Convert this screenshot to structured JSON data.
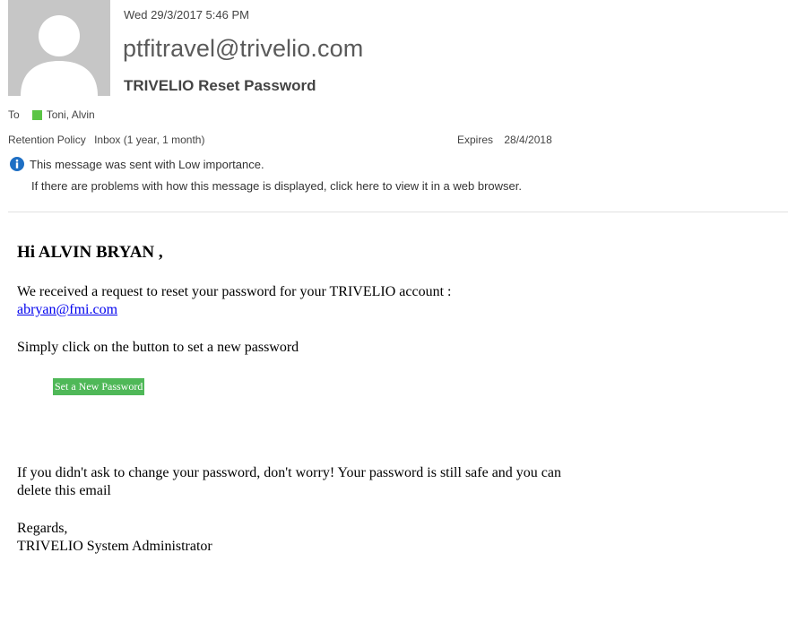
{
  "header": {
    "date": "Wed 29/3/2017 5:46 PM",
    "sender": "ptfitravel@trivelio.com",
    "subject": "TRIVELIO Reset Password",
    "to_label": "To",
    "recipient": "Toni, Alvin",
    "presence_color": "#5bc545",
    "retention_label": "Retention Policy",
    "retention_value": "Inbox (1 year, 1 month)",
    "expires_label": "Expires",
    "expires_value": "28/4/2018",
    "importance_icon": "info-icon",
    "importance_text": "This message was sent with Low importance.",
    "browser_text": "If there are problems with how this message is displayed, click here to view it in a web browser."
  },
  "email": {
    "greeting": "Hi ALVIN BRYAN ,",
    "request_text": "We received a request to reset your password for your TRIVELIO account :",
    "account_email": "abryan@fmi.com",
    "instruction": "Simply click on the button to set a new password",
    "button_label": "Set a New Password",
    "button_color": "#4fb858",
    "reassurance_line1": "If you didn't ask to change your password, don't worry! Your password is still safe and you can",
    "reassurance_line2": "delete this email",
    "closing": "Regards,",
    "signature": "TRIVELIO System Administrator",
    "link_color": "#0000ee"
  }
}
